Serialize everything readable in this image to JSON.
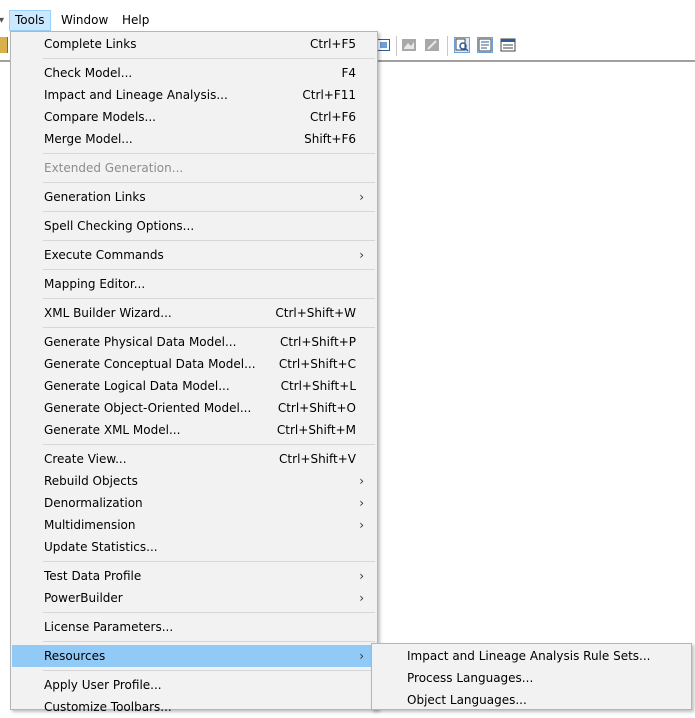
{
  "menubar": {
    "items": [
      {
        "label": "Tools",
        "active": true
      },
      {
        "label": "Window",
        "active": false
      },
      {
        "label": "Help",
        "active": false
      }
    ]
  },
  "tools_menu": {
    "items": [
      {
        "label": "Complete Links",
        "shortcut": "Ctrl+F5"
      },
      {
        "label": "Check Model...",
        "shortcut": "F4"
      },
      {
        "label": "Impact and Lineage Analysis...",
        "shortcut": "Ctrl+F11"
      },
      {
        "label": "Compare Models...",
        "shortcut": "Ctrl+F6"
      },
      {
        "label": "Merge Model...",
        "shortcut": "Shift+F6"
      },
      {
        "label": "Extended Generation...",
        "shortcut": "",
        "disabled": true
      },
      {
        "label": "Generation Links",
        "shortcut": "",
        "submenu": true
      },
      {
        "label": "Spell Checking Options...",
        "shortcut": ""
      },
      {
        "label": "Execute Commands",
        "shortcut": "",
        "submenu": true
      },
      {
        "label": "Mapping Editor...",
        "shortcut": ""
      },
      {
        "label": "XML Builder Wizard...",
        "shortcut": "Ctrl+Shift+W"
      },
      {
        "label": "Generate Physical Data Model...",
        "shortcut": "Ctrl+Shift+P"
      },
      {
        "label": "Generate Conceptual Data Model...",
        "shortcut": "Ctrl+Shift+C"
      },
      {
        "label": "Generate Logical Data Model...",
        "shortcut": "Ctrl+Shift+L"
      },
      {
        "label": "Generate Object-Oriented Model...",
        "shortcut": "Ctrl+Shift+O"
      },
      {
        "label": "Generate XML Model...",
        "shortcut": "Ctrl+Shift+M"
      },
      {
        "label": "Create View...",
        "shortcut": "Ctrl+Shift+V"
      },
      {
        "label": "Rebuild Objects",
        "shortcut": "",
        "submenu": true
      },
      {
        "label": "Denormalization",
        "shortcut": "",
        "submenu": true
      },
      {
        "label": "Multidimension",
        "shortcut": "",
        "submenu": true
      },
      {
        "label": "Update Statistics...",
        "shortcut": ""
      },
      {
        "label": "Test Data Profile",
        "shortcut": "",
        "submenu": true
      },
      {
        "label": "PowerBuilder",
        "shortcut": "",
        "submenu": true
      },
      {
        "label": "License Parameters...",
        "shortcut": ""
      },
      {
        "label": "Resources",
        "shortcut": "",
        "submenu": true,
        "highlighted": true
      },
      {
        "label": "Apply User Profile...",
        "shortcut": ""
      },
      {
        "label": "Customize Toolbars...",
        "shortcut": ""
      }
    ],
    "submenu_arrow": "›"
  },
  "resources_submenu": {
    "items": [
      {
        "label": "Impact and Lineage Analysis Rule Sets..."
      },
      {
        "label": "Process Languages..."
      },
      {
        "label": "Object Languages..."
      }
    ]
  },
  "toolbar": {
    "icons": [
      "diagram-icon",
      "image-icon",
      "image-edit-icon",
      "zoom-page-icon",
      "list-view-icon",
      "detail-view-icon"
    ]
  },
  "colors": {
    "menu_bg": "#f2f2f2",
    "highlight": "#91c9f7",
    "menubar_active": "#cce8ff",
    "disabled_text": "#8d8d8d"
  }
}
